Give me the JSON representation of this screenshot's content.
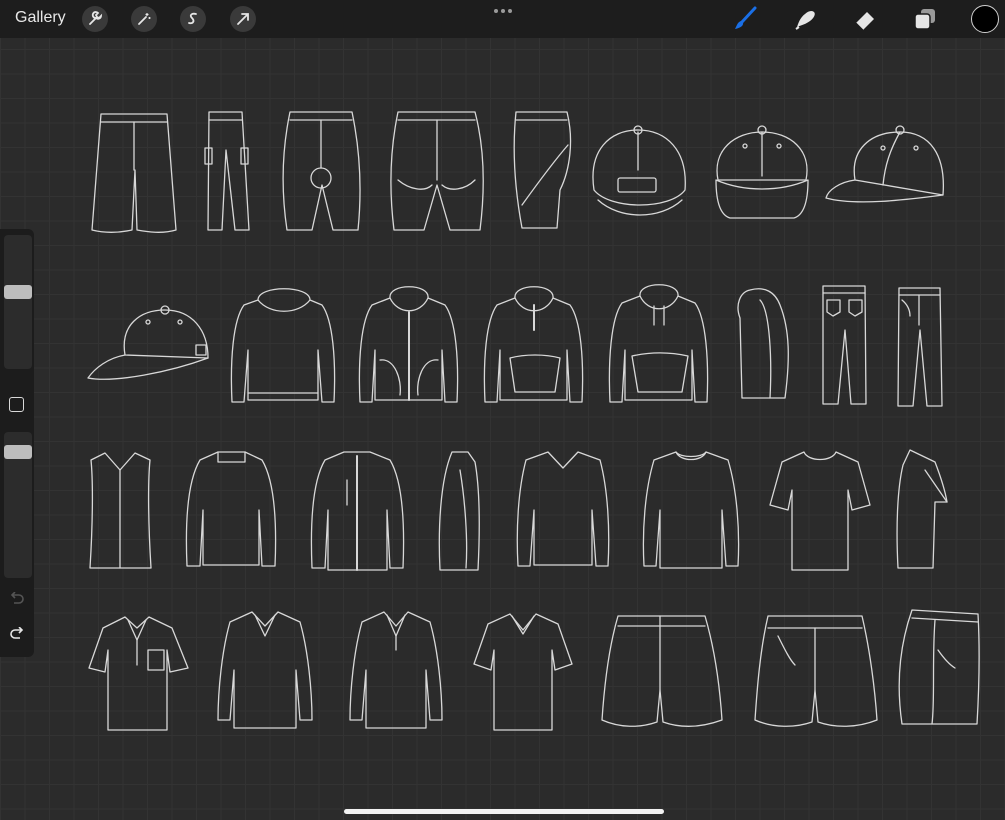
{
  "app": {
    "gallery_label": "Gallery",
    "accent_color": "#1a6fe6"
  },
  "toolbar_left": [
    {
      "name": "actions-wrench-icon"
    },
    {
      "name": "adjustments-wand-icon"
    },
    {
      "name": "selection-s-icon"
    },
    {
      "name": "transform-arrow-icon"
    }
  ],
  "toolbar_right": [
    {
      "name": "brush-icon",
      "active": true
    },
    {
      "name": "smudge-icon",
      "active": false
    },
    {
      "name": "eraser-icon",
      "active": false
    },
    {
      "name": "layers-icon",
      "active": false
    }
  ],
  "current_color": "#000000",
  "sidebar": {
    "brush_size_level": 0.25,
    "opacity_level": 0.1
  },
  "canvas": {
    "line_color": "#d8d8d8",
    "rows": [
      [
        "shorts-long",
        "cargo-pants",
        "cycling-shorts-back",
        "cycling-shorts-front",
        "cycling-shorts-side",
        "cap-back",
        "cap-front",
        "cap-side"
      ],
      [
        "cap-side-2",
        "hoodie-back",
        "hoodie-zip-front",
        "hoodie-quarter-zip",
        "hoodie-pullover",
        "hoodie-side",
        "jeans-back",
        "jeans-front"
      ],
      [
        "vest",
        "jacket-back",
        "jacket-zip-front",
        "jacket-side",
        "v-neck-long-sleeve",
        "crew-long-sleeve",
        "t-shirt",
        "t-shirt-side"
      ],
      [
        "polo-pocket",
        "polo-long-sleeve",
        "polo-long-sleeve-2",
        "polo-v-collar",
        "shorts-back",
        "shorts-front",
        "shorts-side"
      ]
    ]
  }
}
